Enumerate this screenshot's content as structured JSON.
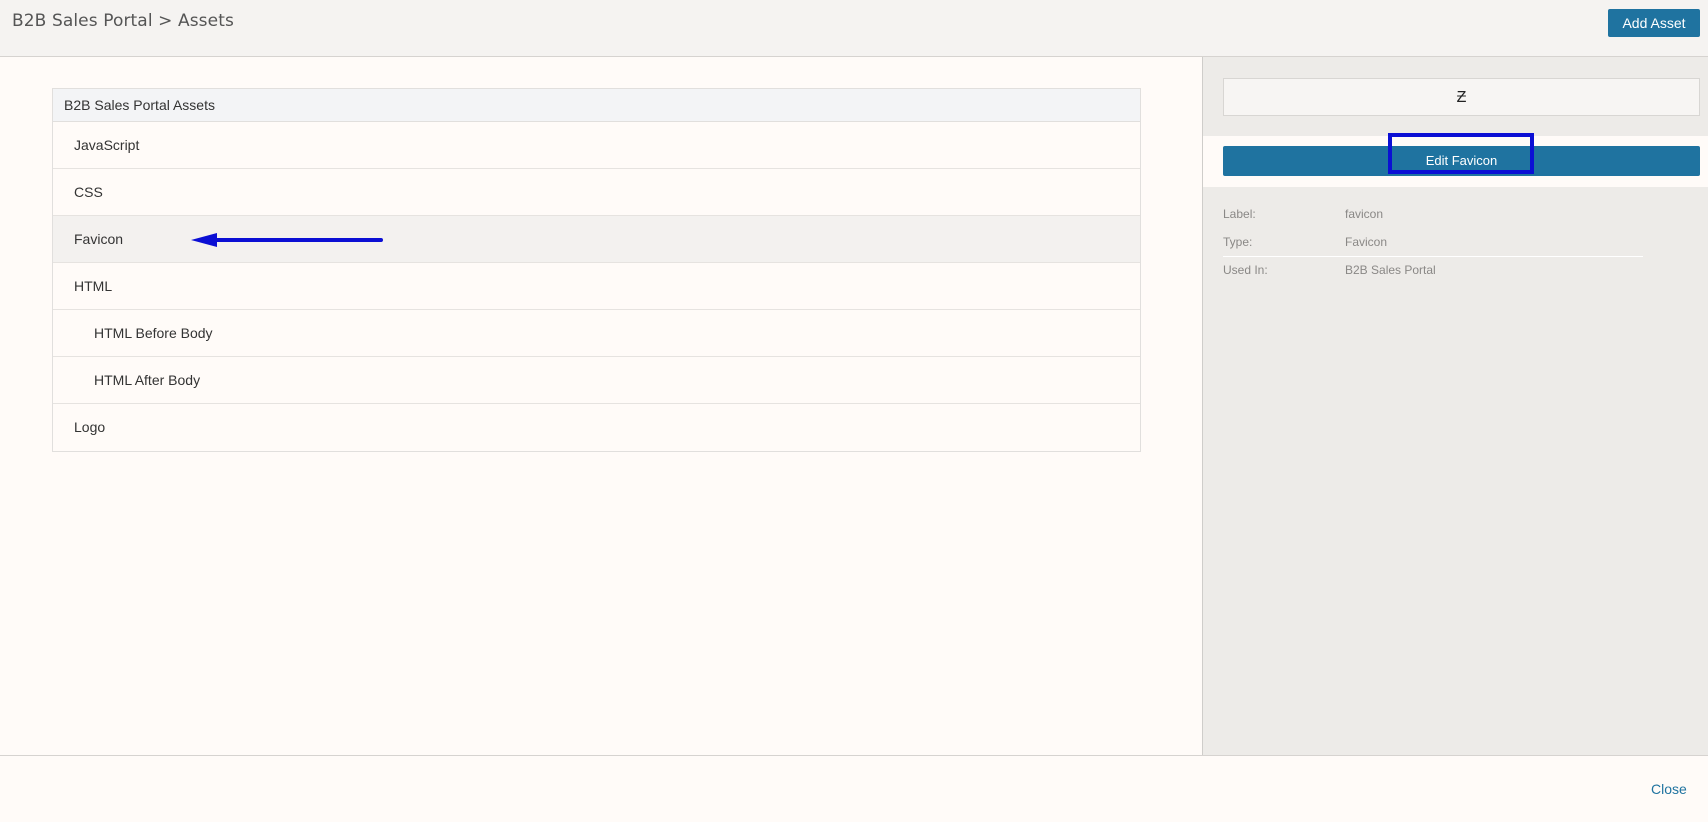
{
  "header": {
    "breadcrumb": "B2B Sales Portal > Assets",
    "add_asset_label": "Add Asset"
  },
  "tree": {
    "header": "B2B Sales Portal Assets",
    "items": [
      {
        "label": "JavaScript"
      },
      {
        "label": "CSS"
      },
      {
        "label": "Favicon"
      },
      {
        "label": "HTML"
      },
      {
        "label": "HTML Before Body"
      },
      {
        "label": "HTML After Body"
      },
      {
        "label": "Logo"
      }
    ]
  },
  "details": {
    "preview_glyph": "Ƶ",
    "edit_button_label": "Edit Favicon",
    "fields": [
      {
        "key": "Label:",
        "value": "favicon"
      },
      {
        "key": "Type:",
        "value": "Favicon"
      },
      {
        "key": "Used In:",
        "value": "B2B Sales Portal"
      }
    ]
  },
  "footer": {
    "close_label": "Close"
  },
  "colors": {
    "primary": "#1f73a0",
    "annotation": "#0b0fd4"
  }
}
